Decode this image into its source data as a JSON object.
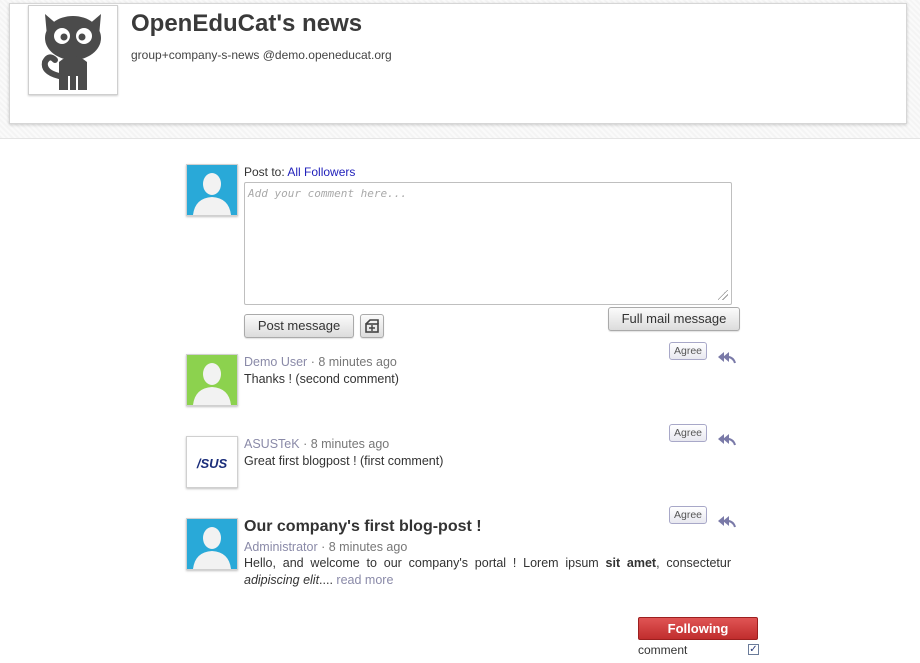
{
  "group": {
    "title": "OpenEduCat's news",
    "email": "group+company-s-news @demo.openeducat.org"
  },
  "composer": {
    "post_to_label": "Post to:",
    "post_to_target": "All Followers",
    "placeholder": "Add your comment here...",
    "post_button": "Post message",
    "full_mail_button": "Full mail message"
  },
  "messages": [
    {
      "author": "Demo User",
      "time": "8 minutes ago",
      "body": "Thanks ! (second comment)",
      "agree_label": "Agree",
      "avatar_color": "#8cd24e"
    },
    {
      "author": "ASUSTeK",
      "time": "8 minutes ago",
      "body": "Great first blogpost ! (first comment)",
      "agree_label": "Agree",
      "avatar_logo": "/SUS"
    },
    {
      "title": "Our company's first blog-post !",
      "author": "Administrator",
      "time": "8 minutes ago",
      "body_start": "Hello, and welcome to our company's portal ! Lorem ipsum ",
      "body_bold": "sit amet",
      "body_mid": ", consectetur ",
      "body_italic": "adipiscing elit",
      "body_end": ".... ",
      "read_more": "read more",
      "agree_label": "Agree",
      "avatar_color": "#29a9d8"
    }
  ],
  "follow": {
    "button_label": "Following",
    "subtype_label": "comment",
    "subtype_checked": true,
    "button_color": "#cc3333"
  },
  "colors": {
    "link": "#2222bb",
    "author": "#8a8aa8",
    "avatar_blue": "#29a9d8"
  }
}
